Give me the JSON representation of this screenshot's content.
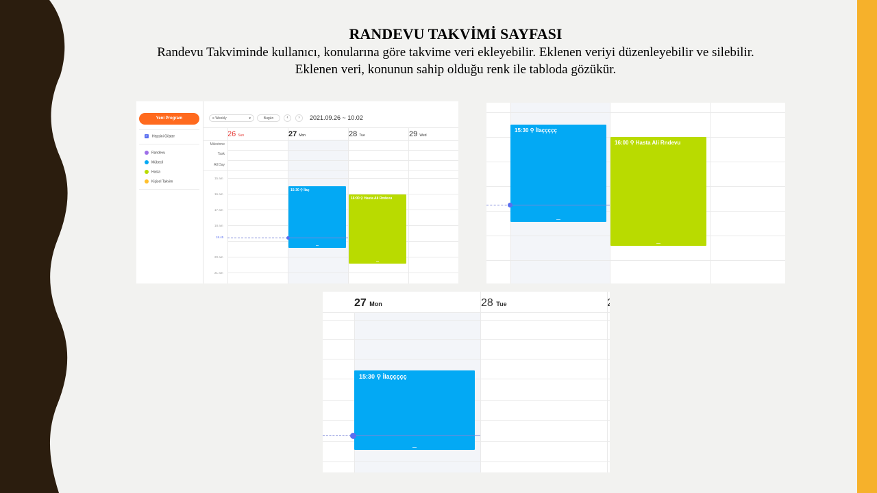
{
  "slide": {
    "title": "RANDEVU TAKVİMİ SAYFASI",
    "line1": "Randevu Takviminde kullanıcı, konularına göre takvime veri ekleyebilir. Eklenen veriyi düzenleyebilir ve silebilir.",
    "line2": "Eklenen veri, konunun sahip olduğu renk ile tabloda gözükür.",
    "colors": {
      "accent_strip": "#f6b12b",
      "wave": "#2b1d0e",
      "background": "#f2f2f0"
    }
  },
  "calendar": {
    "new_button": "Yeni Program",
    "show_all": "Hepsini Göster",
    "calendars": [
      {
        "label": "Randevu",
        "color": "#9e6fe8"
      },
      {
        "label": "Mübecil",
        "color": "#03a9f4"
      },
      {
        "label": "Hasta",
        "color": "#b9db00"
      },
      {
        "label": "Kişisel Takvim",
        "color": "#ffc02c"
      }
    ],
    "view_select": "Weekly",
    "today_button": "Bugün",
    "prev_icon": "chevron-left-icon",
    "next_icon": "chevron-right-icon",
    "date_range": "2021.09.26 ~ 10.02",
    "days": [
      {
        "num": "26",
        "name": "Sun"
      },
      {
        "num": "27",
        "name": "Mon"
      },
      {
        "num": "28",
        "name": "Tue"
      },
      {
        "num": "29",
        "name": "Wed"
      }
    ],
    "row_labels": [
      "Milestone",
      "Task",
      "All Day"
    ],
    "hours": [
      "15 am",
      "16 am",
      "17 am",
      "18 am",
      "20 am",
      "21 am"
    ],
    "now_label": "18.45",
    "events": [
      {
        "id": "blue",
        "label_short": "15:30 ⚲ İlaç",
        "label_full": "15:30 ⚲ İlaççççç",
        "color": "#03a9f4"
      },
      {
        "id": "green",
        "label_short": "16:00 ⚲ Hasta Ali Rndevu",
        "label_full": "16:00 ⚲ Hasta Ali Rndevu",
        "color": "#b9db00"
      }
    ],
    "shot3_days": [
      {
        "num": "27",
        "name": "Mon"
      },
      {
        "num": "28",
        "name": "Tue"
      },
      {
        "num": "2",
        "name": ""
      }
    ]
  }
}
